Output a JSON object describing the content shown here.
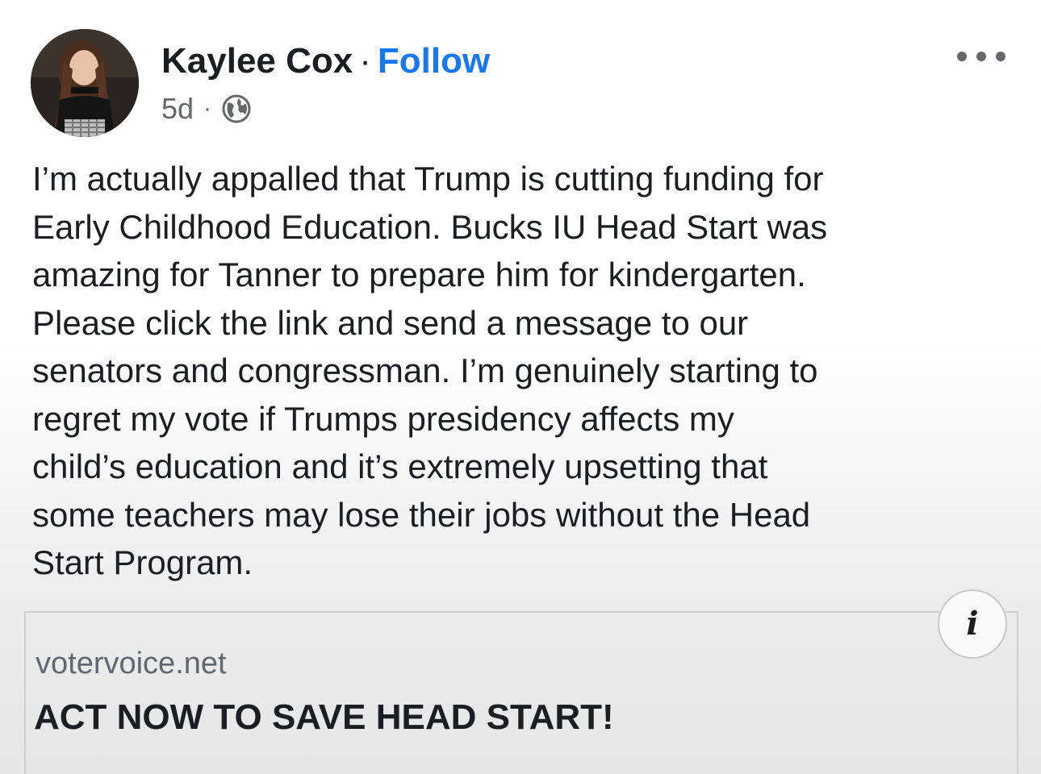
{
  "post": {
    "author": "Kaylee Cox",
    "separator": "·",
    "follow_label": "Follow",
    "timestamp": "5d",
    "meta_separator": "·",
    "privacy_icon": "globe-icon",
    "more_icon": "more-options-icon",
    "text": "I’m actually appalled that Trump is cutting funding for\nEarly Childhood Education. Bucks IU Head Start was\namazing for Tanner to prepare him for kindergarten.\nPlease click the link and send a message to our\nsenators and congressman. I’m genuinely starting to\nregret my vote if Trumps presidency affects my\nchild’s education and it’s extremely upsetting that\nsome teachers may lose their jobs without the Head\nStart Program."
  },
  "link_preview": {
    "info_label": "i",
    "domain": "votervoice.net",
    "title": "ACT NOW TO SAVE HEAD START!"
  },
  "colors": {
    "follow": "#1877f2",
    "secondary_text": "#65676b",
    "primary_text": "#1c1e21"
  }
}
